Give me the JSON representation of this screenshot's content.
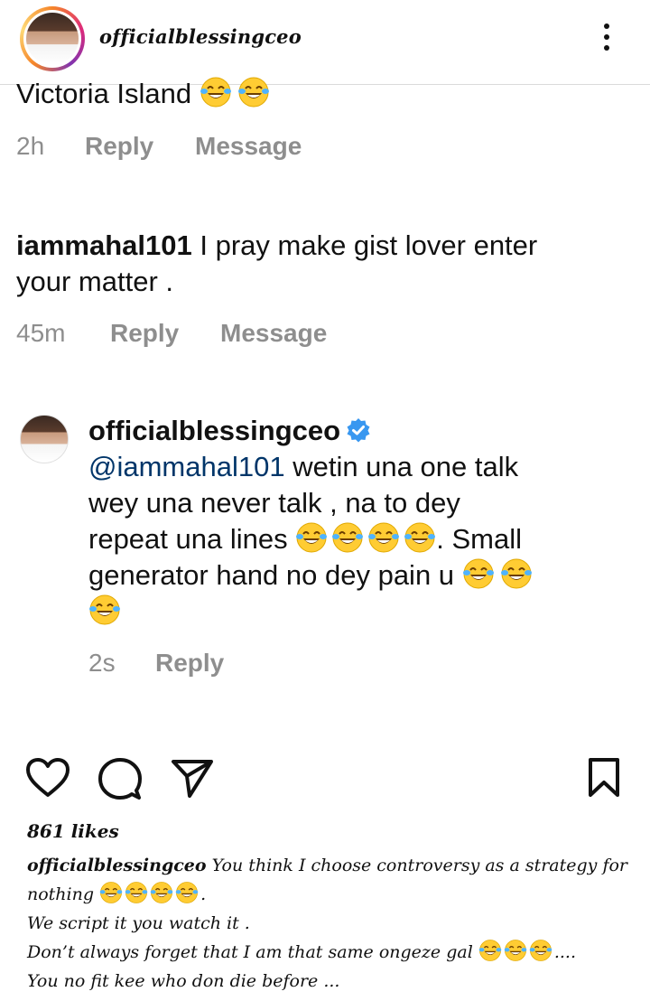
{
  "header": {
    "username": "officialblessingceo",
    "menu_icon": "more-vertical-icon"
  },
  "comments": [
    {
      "text": "Victoria Island",
      "emoji_count": 2,
      "time": "2h",
      "reply": "Reply",
      "message": "Message"
    },
    {
      "username": "iammahal101",
      "text_line1": "I pray make gist lover enter",
      "text_line2": "your matter .",
      "time": "45m",
      "reply": "Reply",
      "message": "Message"
    },
    {
      "username": "officialblessingceo",
      "verified": true,
      "mention": "@iammahal101",
      "line1": "wetin una one talk",
      "line2": "wey una never talk , na to dey",
      "line3a": "repeat una lines",
      "line3b": ". Small",
      "line4": "generator hand no dey pain u",
      "time": "2s",
      "reply": "Reply"
    }
  ],
  "actions": {
    "like_icon": "heart-icon",
    "comment_icon": "comment-bubble-icon",
    "share_icon": "send-icon",
    "save_icon": "bookmark-icon"
  },
  "likes": "861 likes",
  "caption": {
    "username": "officialblessingceo",
    "line1": "You think I choose controversy as a strategy for",
    "line2": "nothing",
    "line2_end": ".",
    "line3": "We script it you watch it .",
    "line4": "Don’t always forget that I am that same ongeze gal",
    "line4_end": "....",
    "line5": "You no fit kee who don die before ..."
  },
  "colors": {
    "mention": "#003569",
    "verified": "#3897f0",
    "meta": "#8e8e8e",
    "emoji": "#ffcc33"
  }
}
